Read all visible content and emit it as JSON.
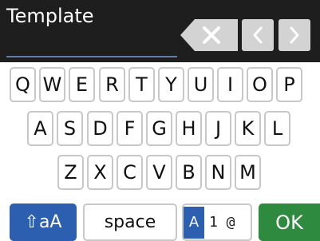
{
  "header": {
    "title": "Template",
    "delete_icon": "backspace-x-icon",
    "prev_icon": "chevron-left-icon",
    "next_icon": "chevron-right-icon"
  },
  "keyboard": {
    "row1": [
      "Q",
      "W",
      "E",
      "R",
      "T",
      "Y",
      "U",
      "I",
      "O",
      "P"
    ],
    "row2": [
      "A",
      "S",
      "D",
      "F",
      "G",
      "H",
      "J",
      "K",
      "L"
    ],
    "row3": [
      "Z",
      "X",
      "C",
      "V",
      "B",
      "N",
      "M"
    ],
    "shift": "⇧aA",
    "space": "space",
    "mode_active": "A",
    "mode_rest": "1 @",
    "ok": "OK"
  },
  "colors": {
    "header_bg": "#1e1e1e",
    "accent_blue": "#2c5fb0",
    "ok_green": "#2d8a3e",
    "key_border": "#c8c8c8"
  }
}
